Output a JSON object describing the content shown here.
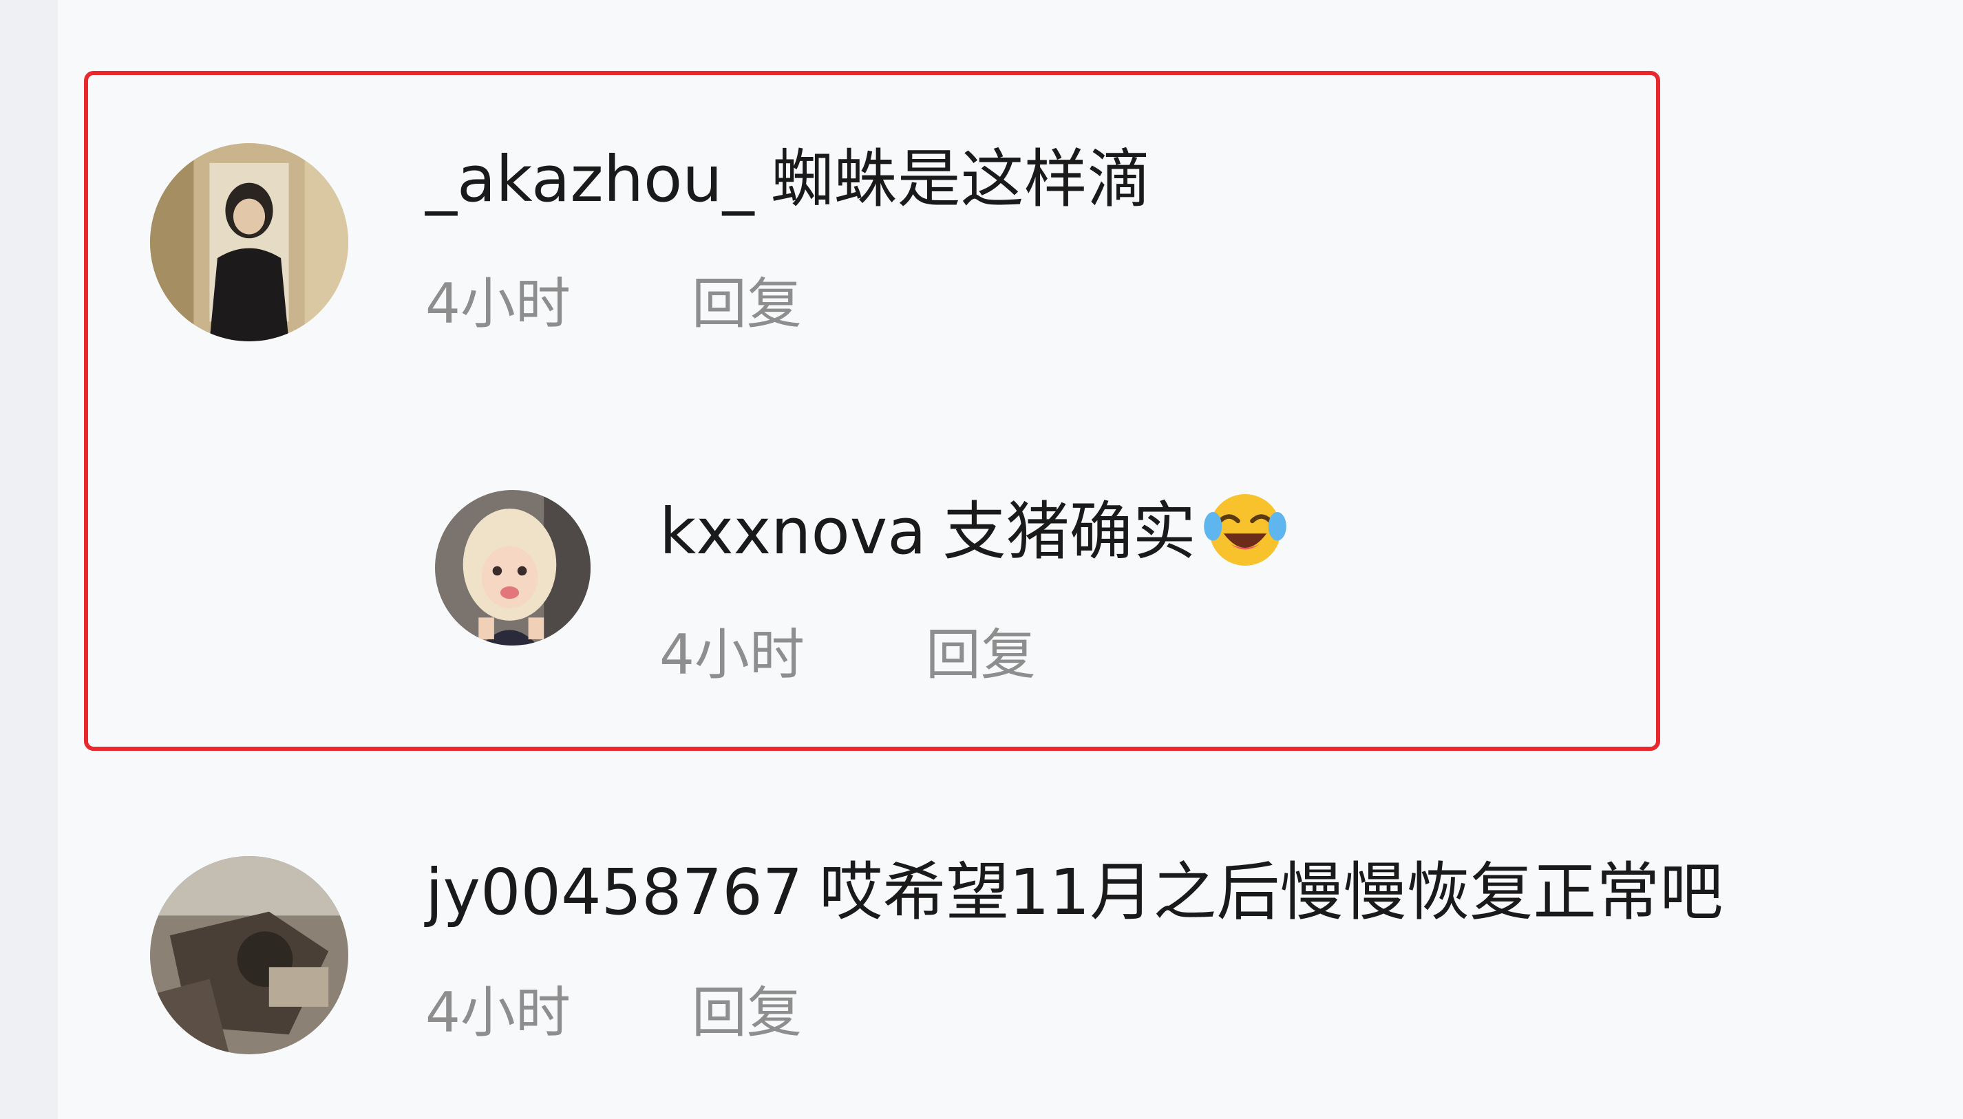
{
  "comments": [
    {
      "username": "_akazhou_",
      "text": "蜘蛛是这样滴",
      "time": "4小时",
      "reply_label": "回复"
    },
    {
      "username": "kxxnova",
      "text": "支猪确实",
      "emoji": "face-with-tears-of-joy",
      "time": "4小时",
      "reply_label": "回复"
    },
    {
      "username": "jy00458767",
      "text": "哎希望11月之后慢慢恢复正常吧",
      "time": "4小时",
      "reply_label": "回复"
    }
  ],
  "highlight_color": "#e8282d"
}
